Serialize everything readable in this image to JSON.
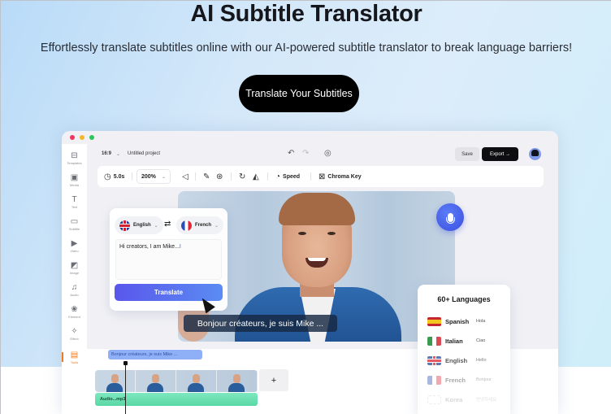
{
  "hero": {
    "title": "AI Subtitle Translator",
    "subtitle": "Effortlessly translate subtitles online with our AI-powered subtitle translator to break language barriers!",
    "cta_label": "Translate Your Subtitles"
  },
  "app": {
    "window_controls": [
      "close",
      "minimize",
      "maximize"
    ],
    "sidebar": {
      "items": [
        {
          "label": "Templates",
          "icon": "template-icon",
          "glyph": "⊟"
        },
        {
          "label": "Media",
          "icon": "media-folder-icon",
          "glyph": "▣"
        },
        {
          "label": "Text",
          "icon": "text-icon",
          "glyph": "T"
        },
        {
          "label": "Subtitle",
          "icon": "subtitle-icon",
          "glyph": "▭"
        },
        {
          "label": "Video",
          "icon": "video-icon",
          "glyph": "▶"
        },
        {
          "label": "Image",
          "icon": "image-icon",
          "glyph": "◩"
        },
        {
          "label": "Audio",
          "icon": "audio-icon",
          "glyph": "♫"
        },
        {
          "label": "Element",
          "icon": "element-icon",
          "glyph": "❀"
        },
        {
          "label": "Effect",
          "icon": "effect-icon",
          "glyph": "✧"
        },
        {
          "label": "Tools",
          "icon": "tools-icon",
          "glyph": "▤",
          "active": true
        }
      ]
    },
    "topbar": {
      "aspect_ratio": "16:9",
      "project_name": "Untitled project",
      "save_label": "Save",
      "export_label": "Export →"
    },
    "toolbar": {
      "duration": "5.0s",
      "zoom": "200%",
      "speed_label": "Speed",
      "chroma_key_label": "Chroma Key"
    },
    "translate_panel": {
      "source_language": "English",
      "target_language": "French",
      "input_text": "Hi creators, I am Mike...",
      "button_label": "Translate"
    },
    "video": {
      "subtitle": "Bonjour créateurs, je suis Mike ..."
    },
    "languages_panel": {
      "title": "60+ Languages",
      "languages": [
        {
          "name": "Spanish",
          "greeting": "Hola"
        },
        {
          "name": "Italian",
          "greeting": "Ciao"
        },
        {
          "name": "English",
          "greeting": "Hello"
        },
        {
          "name": "French",
          "greeting": "Bonjour"
        },
        {
          "name": "Korea",
          "greeting": "안녕하세요"
        }
      ]
    },
    "timeline": {
      "subtitle_clip": "Bonjour créateurs, je suis Mike ...",
      "audio_clip": "Audio...mp3",
      "add_label": "+"
    }
  }
}
